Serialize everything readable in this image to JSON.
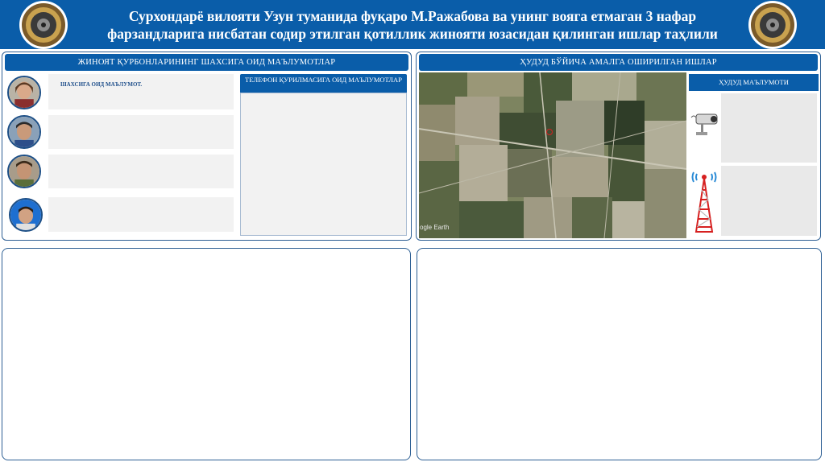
{
  "header": {
    "title_line1": "Сурхондарё вилояти Узун туманида фуқаро М.Ражабова ва унинг вояга етмаган 3 нафар",
    "title_line2": "фарзандларига нисбатан содир этилган қотиллик жинояти юзасидан қилинган ишлар таҳлили"
  },
  "left_panel": {
    "title": "ЖИНОЯТ ҚУРБОНЛАРИНИНГ ШАХСИГА ОИД МАЪЛУМОТЛАР",
    "person_info_label": "ШАХСИГА ОИД МАЪЛУМОТ.",
    "phone_title": "ТЕЛЕФОН ҚУРИЛМАСИГА ОИД МАЪЛУМОТЛАР"
  },
  "right_panel": {
    "title": "ҲУДУД БЎЙИЧА АМАЛГА ОШИРИЛГАН ИШЛАР",
    "map_credit": "ogle Earth",
    "zone_title": "ҲУДУД МАЪЛУМОТИ"
  },
  "colors": {
    "header_blue": "#0a5da9",
    "panel_border": "#2d5f94",
    "box_gray": "#f2f2f2"
  },
  "icons": [
    "emblem-icon",
    "cctv-camera-icon",
    "cell-tower-icon",
    "location-marker-icon"
  ]
}
